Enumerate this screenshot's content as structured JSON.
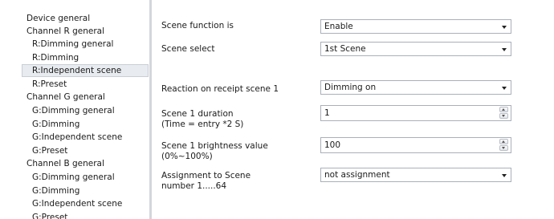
{
  "tree": {
    "items": [
      {
        "label": "Device general"
      },
      {
        "label": "Channel R general"
      },
      {
        "label": "R:Dimming general"
      },
      {
        "label": "R:Dimming"
      },
      {
        "label": "R:Independent scene"
      },
      {
        "label": "R:Preset"
      },
      {
        "label": "Channel G general"
      },
      {
        "label": "G:Dimming general"
      },
      {
        "label": "G:Dimming"
      },
      {
        "label": "G:Independent scene"
      },
      {
        "label": "G:Preset"
      },
      {
        "label": "Channel B general"
      },
      {
        "label": "G:Dimming general"
      },
      {
        "label": "G:Dimming"
      },
      {
        "label": "G:Independent scene"
      },
      {
        "label": "G:Preset"
      }
    ],
    "selected": "R:Independent scene"
  },
  "params": {
    "scene_function": {
      "label": "Scene function is",
      "value": "Enable"
    },
    "scene_select": {
      "label": "Scene  select",
      "value": "1st Scene"
    },
    "reaction": {
      "label": "Reaction on receipt scene 1",
      "value": "Dimming on"
    },
    "duration": {
      "label_line1": "Scene 1 duration",
      "label_line2": "(Time = entry *2 S)",
      "value": "1"
    },
    "brightness": {
      "label_line1": "Scene 1 brightness value",
      "label_line2": "(0%~100%)",
      "value": "100"
    },
    "assignment": {
      "label_line1": "Assignment to Scene",
      "label_line2": "number 1.....64",
      "value": "not assignment"
    }
  },
  "colors": {
    "divider": "#d3d6db",
    "selected_bg": "#e8ebef",
    "field_border": "#a9b0ba"
  }
}
